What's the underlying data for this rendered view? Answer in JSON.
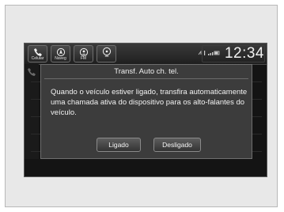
{
  "topbar": {
    "buttons": [
      {
        "label": "Celular",
        "icon": "phone-icon"
      },
      {
        "label": "Naveg",
        "icon": "navigation-icon"
      },
      {
        "label": "FM",
        "icon": "radio-icon"
      },
      {
        "label": "",
        "icon": "audio-source-icon"
      }
    ],
    "clock": "12:34"
  },
  "dialog": {
    "title": "Transf. Auto ch. tel.",
    "message": "Quando o veículo estiver ligado, transfira automaticamente uma chamada ativa do dispositivo para os alto-falantes do veículo.",
    "btn_on": "Ligado",
    "btn_off": "Desligado"
  }
}
